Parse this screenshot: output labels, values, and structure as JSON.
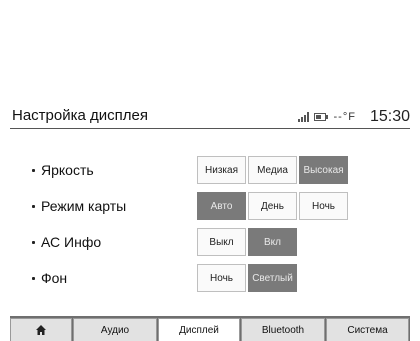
{
  "header": {
    "title": "Настройка дисплея",
    "temperature": "--°F",
    "time": "15:30"
  },
  "settings": [
    {
      "label": "Яркость",
      "options": [
        "Низкая",
        "Медиа",
        "Высокая"
      ],
      "selected": 2
    },
    {
      "label": "Режим карты",
      "options": [
        "Авто",
        "День",
        "Ночь"
      ],
      "selected": 0
    },
    {
      "label": "АС Инфо",
      "options": [
        "Выкл",
        "Вкл"
      ],
      "selected": 1
    },
    {
      "label": "Фон",
      "options": [
        "Ночь",
        "Светлый"
      ],
      "selected": 1
    }
  ],
  "tabs": {
    "home_icon": "home-icon",
    "audio": "Аудио",
    "display": "Дисплей",
    "bluetooth": "Bluetooth",
    "system": "Система",
    "active": "display"
  }
}
